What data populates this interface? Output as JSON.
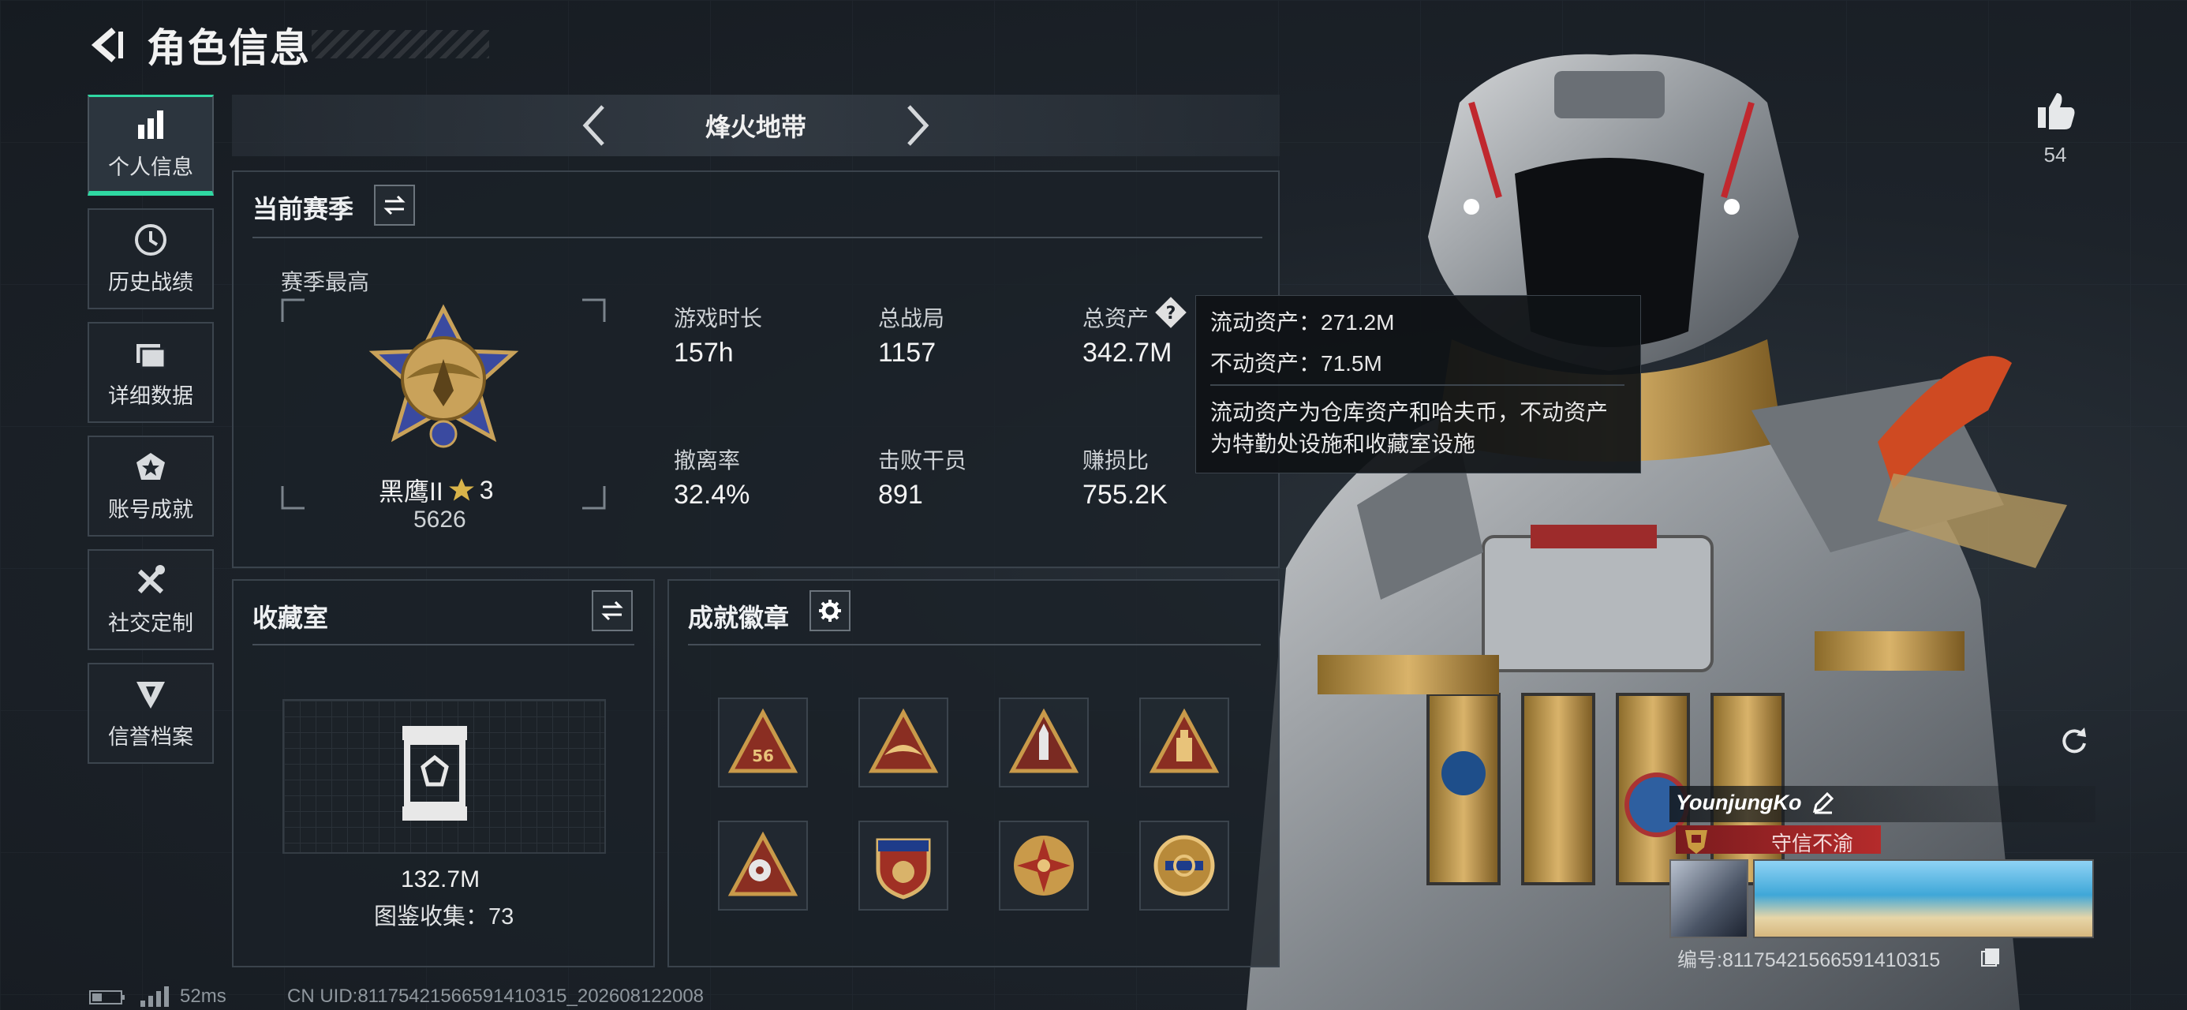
{
  "header": {
    "title": "角色信息"
  },
  "sidebar": {
    "items": [
      {
        "label": "个人信息",
        "icon": "bar-chart-icon"
      },
      {
        "label": "历史战绩",
        "icon": "clock-icon"
      },
      {
        "label": "详细数据",
        "icon": "folder-icon"
      },
      {
        "label": "账号成就",
        "icon": "medal-icon"
      },
      {
        "label": "社交定制",
        "icon": "tools-icon"
      },
      {
        "label": "信誉档案",
        "icon": "shield-icon"
      }
    ]
  },
  "mode": {
    "title": "烽火地带"
  },
  "season": {
    "title": "当前赛季",
    "best_label": "赛季最高",
    "rank_name": "黑鹰II",
    "rank_stars": "3",
    "rank_score": "5626",
    "stats": [
      {
        "label": "游戏时长",
        "value": "157h"
      },
      {
        "label": "总战局",
        "value": "1157"
      },
      {
        "label": "总资产",
        "value": "342.7M"
      },
      {
        "label": "撤离率",
        "value": "32.4%"
      },
      {
        "label": "击败干员",
        "value": "891"
      },
      {
        "label": "赚损比",
        "value": "755.2K"
      }
    ]
  },
  "tooltip": {
    "liquid": "流动资产：271.2M",
    "fixed": "不动资产：71.5M",
    "desc_line1": "流动资产为仓库资产和哈夫币，不动资产",
    "desc_line2": "为特勤处设施和收藏室设施"
  },
  "collection": {
    "title": "收藏室",
    "value": "132.7M",
    "codex": "图鉴收集：73"
  },
  "badges": {
    "title": "成就徽章",
    "count_label": "56"
  },
  "likes": {
    "count": "54"
  },
  "player": {
    "name": "YounjungKo",
    "honor": "守信不渝",
    "id": "编号:8117542156659141031​5"
  },
  "status": {
    "ping": "52ms",
    "cn_uid": "CN UID:8117542156659141031​5_202608122008"
  },
  "colors": {
    "accent": "#2fd8a2",
    "honor_red": "#b52b2b"
  }
}
